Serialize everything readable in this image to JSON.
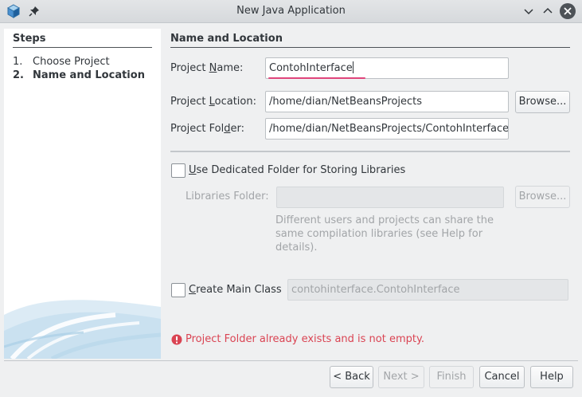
{
  "window": {
    "title": "New Java Application"
  },
  "steps": {
    "heading": "Steps",
    "items": [
      {
        "num": "1.",
        "label": "Choose Project"
      },
      {
        "num": "2.",
        "label": "Name and Location"
      }
    ]
  },
  "name_location": {
    "heading": "Name and Location",
    "project_name": {
      "label_pre": "Project ",
      "label_key": "N",
      "label_post": "ame:",
      "value": "ContohInterface"
    },
    "project_location": {
      "label_pre": "Project ",
      "label_key": "L",
      "label_post": "ocation:",
      "value": "/home/dian/NetBeansProjects",
      "browse_label": "Browse..."
    },
    "project_folder": {
      "label_pre": "Project Fol",
      "label_key": "d",
      "label_post": "er:",
      "value": "/home/dian/NetBeansProjects/ContohInterface"
    }
  },
  "libraries": {
    "checkbox_key": "U",
    "checkbox_rest": "se Dedicated Folder for Storing Libraries",
    "checked": false,
    "folder_label": "Libraries Folder:",
    "folder_value": "",
    "browse_label": "Browse...",
    "hint_lines": [
      "Different users and projects can share the",
      "same compilation libraries (see Help for",
      "details)."
    ]
  },
  "main_class": {
    "checkbox_key": "C",
    "checkbox_rest": "reate Main Class",
    "checked": false,
    "value": "contohinterface.ContohInterface"
  },
  "error": {
    "message": "Project Folder already exists and is not empty."
  },
  "buttons": {
    "back": "< Back",
    "next": "Next >",
    "finish": "Finish",
    "cancel": "Cancel",
    "help": "Help"
  },
  "colors": {
    "accent_focus": "#e0457b",
    "error": "#da4453",
    "window_bg": "#eff0f1"
  }
}
